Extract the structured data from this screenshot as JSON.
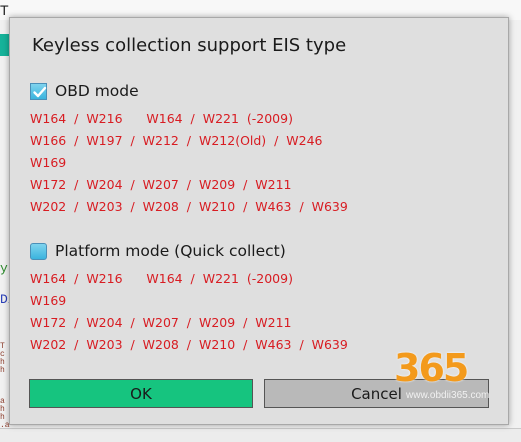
{
  "background": {
    "title": "T",
    "fragments": [
      "y",
      "Dı",
      "T\nc\nh\nh",
      "a\nh",
      "h\n.a"
    ]
  },
  "dialog": {
    "title": "Keyless collection support EIS type",
    "obd": {
      "label": "OBD mode",
      "checked": true,
      "lines": [
        "W164  /  W216      W164  /  W221  (-2009)",
        "W166  /  W197  /  W212  /  W212(Old)  /  W246",
        "W169",
        "W172  /  W204  /  W207  /  W209  /  W211",
        "W202  /  W203  /  W208  /  W210  /  W463  /  W639"
      ]
    },
    "platform": {
      "label": "Platform mode (Quick collect)",
      "selected": true,
      "lines": [
        "W164  /  W216      W164  /  W221  (-2009)",
        "W169",
        "W172  /  W204  /  W207  /  W209  /  W211",
        "W202  /  W203  /  W208  /  W210  /  W463  /  W639"
      ]
    },
    "buttons": {
      "ok": "OK",
      "cancel": "Cancel"
    }
  },
  "watermark": {
    "digits": "365",
    "url": "www.obdii365.com"
  },
  "colors": {
    "model_text": "#d81c22",
    "ok_button": "#16c47f",
    "checkbox": "#3bb4de"
  }
}
